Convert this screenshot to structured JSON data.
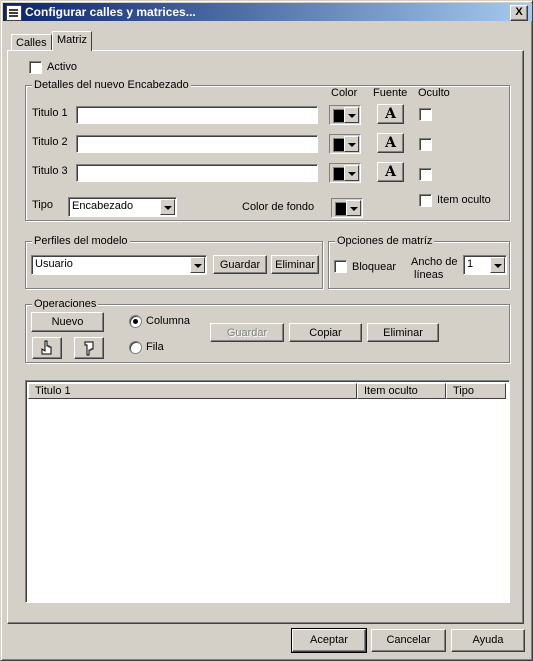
{
  "window": {
    "title": "Configurar calles y matrices...",
    "close_label": "X"
  },
  "tabs": [
    {
      "label": "Calles"
    },
    {
      "label": "Matriz"
    }
  ],
  "activo": {
    "label": "Activo"
  },
  "detalles": {
    "legend": "Detalles del nuevo Encabezado",
    "col_color": "Color",
    "col_fuente": "Fuente",
    "col_oculto": "Oculto",
    "rows": [
      {
        "label": "Titulo 1",
        "value": "",
        "font_glyph": "A"
      },
      {
        "label": "Titulo 2",
        "value": "",
        "font_glyph": "A"
      },
      {
        "label": "Titulo 3",
        "value": "",
        "font_glyph": "A"
      }
    ],
    "tipo_label": "Tipo",
    "tipo_value": "Encabezado",
    "fondo_label": "Color de fondo",
    "item_oculto_label": "Item oculto"
  },
  "perfiles": {
    "legend": "Perfiles del modelo",
    "value": "Usuario",
    "guardar": "Guardar",
    "eliminar": "Eliminar"
  },
  "opciones": {
    "legend": "Opciones de matríz",
    "bloquear": "Bloquear",
    "ancho_line1": "Ancho de",
    "ancho_line2": "líneas",
    "ancho_value": "1"
  },
  "operaciones": {
    "legend": "Operaciones",
    "nuevo": "Nuevo",
    "columna": "Columna",
    "fila": "Fila",
    "guardar": "Guardar",
    "copiar": "Copiar",
    "eliminar": "Eliminar"
  },
  "table": {
    "columns": [
      "Titulo 1",
      "Item oculto",
      "Tipo"
    ],
    "rows": []
  },
  "footer": {
    "aceptar": "Aceptar",
    "cancelar": "Cancelar",
    "ayuda": "Ayuda"
  }
}
